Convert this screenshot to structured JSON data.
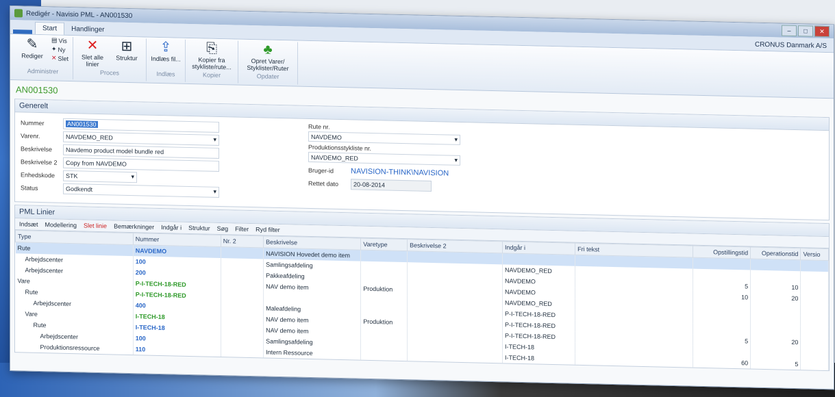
{
  "window": {
    "title": "Redigér - Navisio PML - AN001530"
  },
  "tabs": {
    "file": "",
    "start": "Start",
    "handlinger": "Handlinger"
  },
  "company": "CRONUS Danmark A/S",
  "ribbon": {
    "vis": "Vis",
    "ny": "Ny",
    "slet": "Slet",
    "rediger": "Rediger",
    "administrer": "Administrer",
    "slet_alle": "Slet alle linier",
    "struktur": "Struktur",
    "proces": "Proces",
    "indlaes": "Indlæs fil...",
    "indlaes_group": "Indlæs",
    "kopier": "Kopier fra stykliste/rute...",
    "kopier_group": "Kopier",
    "opret": "Opret Varer/ Styklister/Ruter",
    "opret_group": "Opdater"
  },
  "page_title": "AN001530",
  "general": {
    "header": "Generelt",
    "nummer_label": "Nummer",
    "nummer": "AN001530",
    "varenr_label": "Varenr.",
    "varenr": "NAVDEMO_RED",
    "beskrivelse_label": "Beskrivelse",
    "beskrivelse": "Navdemo product model bundle red",
    "beskrivelse2_label": "Beskrivelse 2",
    "beskrivelse2": "Copy from NAVDEMO",
    "enhedskode_label": "Enhedskode",
    "enhedskode": "STK",
    "status_label": "Status",
    "status": "Godkendt",
    "rute_label": "Rute nr.",
    "rute": "NAVDEMO",
    "prodstykliste_label": "Produktionsstykliste nr.",
    "prodstykliste": "NAVDEMO_RED",
    "bruger_label": "Bruger-id",
    "bruger": "NAVISION-THINK\\NAVISION",
    "rettet_label": "Rettet dato",
    "rettet": "20-08-2014"
  },
  "pml": {
    "header": "PML Linier",
    "toolbar": [
      "Indsæt",
      "Modellering",
      "Slet linie",
      "Bemærkninger",
      "Indgår i",
      "Struktur",
      "Søg",
      "Filter",
      "Ryd filter"
    ],
    "columns": [
      "Type",
      "Nummer",
      "Nr. 2",
      "Beskrivelse",
      "Varetype",
      "Beskrivelse 2",
      "Indgår i",
      "Fri tekst",
      "Opstillingstid",
      "Operationstid",
      "Versio"
    ],
    "rows": [
      {
        "type": "Rute",
        "num": "NAVDEMO",
        "nr2": "",
        "desc": "NAVISION Hovedet demo item",
        "vt": "",
        "d2": "",
        "ind": "",
        "fri": "",
        "op": "",
        "ot": ""
      },
      {
        "type": "Arbejdscenter",
        "num": "100",
        "nr2": "",
        "desc": "Samlingsafdeling",
        "vt": "",
        "d2": "",
        "ind": "NAVDEMO_RED",
        "fri": "",
        "op": "",
        "ot": ""
      },
      {
        "type": "Arbejdscenter",
        "num": "200",
        "nr2": "",
        "desc": "Pakkeafdeling",
        "vt": "",
        "d2": "",
        "ind": "NAVDEMO",
        "fri": "",
        "op": "5",
        "ot": "10"
      },
      {
        "type": "Vare",
        "num": "P-I-TECH-18-RED",
        "nr2": "",
        "desc": "NAV demo item",
        "vt": "Produktion",
        "d2": "",
        "ind": "NAVDEMO",
        "fri": "",
        "op": "10",
        "ot": "20"
      },
      {
        "type": "Rute",
        "num": "P-I-TECH-18-RED",
        "nr2": "",
        "desc": "",
        "vt": "",
        "d2": "",
        "ind": "NAVDEMO_RED",
        "fri": "",
        "op": "",
        "ot": ""
      },
      {
        "type": "Arbejdscenter",
        "num": "400",
        "nr2": "",
        "desc": "Maleafdeling",
        "vt": "",
        "d2": "",
        "ind": "P-I-TECH-18-RED",
        "fri": "",
        "op": "",
        "ot": ""
      },
      {
        "type": "Vare",
        "num": "I-TECH-18",
        "nr2": "",
        "desc": "NAV demo item",
        "vt": "Produktion",
        "d2": "",
        "ind": "P-I-TECH-18-RED",
        "fri": "",
        "op": "",
        "ot": ""
      },
      {
        "type": "Rute",
        "num": "I-TECH-18",
        "nr2": "",
        "desc": "NAV demo item",
        "vt": "",
        "d2": "",
        "ind": "P-I-TECH-18-RED",
        "fri": "",
        "op": "5",
        "ot": "20"
      },
      {
        "type": "Arbejdscenter",
        "num": "100",
        "nr2": "",
        "desc": "Samlingsafdeling",
        "vt": "",
        "d2": "",
        "ind": "I-TECH-18",
        "fri": "",
        "op": "",
        "ot": ""
      },
      {
        "type": "Produktionsressource",
        "num": "110",
        "nr2": "",
        "desc": "Intern Ressource",
        "vt": "",
        "d2": "",
        "ind": "I-TECH-18",
        "fri": "",
        "op": "60",
        "ot": "5"
      }
    ]
  }
}
